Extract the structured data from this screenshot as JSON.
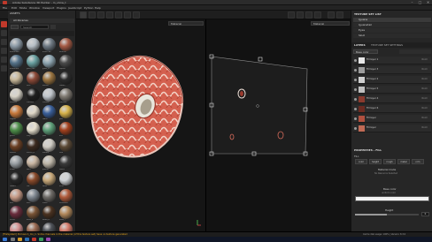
{
  "window": {
    "title": "Adobe Substance 3D Painter - m_show_t",
    "controls": {
      "min": "–",
      "max": "□",
      "close": "✕"
    }
  },
  "menu": [
    "File",
    "Edit",
    "Mode",
    "Window",
    "Viewport",
    "Plugins",
    "JavaScript",
    "Python",
    "Help"
  ],
  "shelf": {
    "title": "ASSETS",
    "category": "All libraries",
    "search_placeholder": "Search",
    "materials": [
      {
        "name": "aluminium",
        "color": "#8c9aa6"
      },
      {
        "name": "aluminium",
        "color": "#b7bfc6"
      },
      {
        "name": "alumi..bn",
        "color": "#6f7a84"
      },
      {
        "name": "artificial",
        "color": "#a55a44"
      },
      {
        "name": "aluminum",
        "color": "#55738a"
      },
      {
        "name": "glass_lam",
        "color": "#6aa1a1"
      },
      {
        "name": "glass_tr",
        "color": "#8fa6b2"
      },
      {
        "name": "asphalt",
        "color": "#4a4a4a"
      },
      {
        "name": "bone",
        "color": "#c9b99a"
      },
      {
        "name": "brick",
        "color": "#8c4a38"
      },
      {
        "name": "bronze",
        "color": "#9a7440"
      },
      {
        "name": "carbon",
        "color": "#2b2b2b"
      },
      {
        "name": "ceramic",
        "color": "#d8d4c8"
      },
      {
        "name": "charcoal",
        "color": "#1f1f1f"
      },
      {
        "name": "chrome",
        "color": "#c0c6cc"
      },
      {
        "name": "concrete",
        "color": "#807a72"
      },
      {
        "name": "copper",
        "color": "#c97a3c"
      },
      {
        "name": "cotton",
        "color": "#e0d8c8"
      },
      {
        "name": "fabric",
        "color": "#3a5f9a"
      },
      {
        "name": "gold",
        "color": "#d7b24a"
      },
      {
        "name": "green",
        "color": "#4e8f4a"
      },
      {
        "name": "ivory",
        "color": "#e8e2d0"
      },
      {
        "name": "jade",
        "color": "#5fa07a"
      },
      {
        "name": "lava",
        "color": "#a3411e"
      },
      {
        "name": "leather",
        "color": "#6b3f23"
      },
      {
        "name": "leather_b",
        "color": "#3b2a1f"
      },
      {
        "name": "marble",
        "color": "#d0ccc4"
      },
      {
        "name": "mud",
        "color": "#5c4a36"
      },
      {
        "name": "nickel",
        "color": "#9aa0a4"
      },
      {
        "name": "paint",
        "color": "#c9b6a2"
      },
      {
        "name": "plaster",
        "color": "#bfb7a9"
      },
      {
        "name": "plastic",
        "color": "#3a3a3a"
      },
      {
        "name": "rubber",
        "color": "#262626"
      },
      {
        "name": "rust",
        "color": "#8a4a2a"
      },
      {
        "name": "sand",
        "color": "#c9a97a"
      },
      {
        "name": "silver",
        "color": "#cfd3d6"
      },
      {
        "name": "skin",
        "color": "#c79a86"
      },
      {
        "name": "steel",
        "color": "#7f8790"
      },
      {
        "name": "stone",
        "color": "#6d6a66"
      },
      {
        "name": "terracotta",
        "color": "#b05a3a"
      },
      {
        "name": "velvet",
        "color": "#6a2c3c"
      },
      {
        "name": "wood_b",
        "color": "#7a5436"
      },
      {
        "name": "wood_d",
        "color": "#4a3220"
      },
      {
        "name": "wood_l",
        "color": "#b48a5c"
      },
      {
        "name": "rose",
        "color": "#d49090"
      },
      {
        "name": "skin_d",
        "color": "#9a6a52"
      },
      {
        "name": "slate",
        "color": "#4e5258"
      },
      {
        "name": "coral",
        "color": "#d47a6a"
      }
    ]
  },
  "viewport": {
    "left_mode": "Material",
    "right_mode": "Material"
  },
  "texture_set_list": {
    "title": "TEXTURE SET LIST",
    "items": [
      "Iguana",
      "Iguanatail",
      "Eyes",
      "Skull"
    ]
  },
  "layers": {
    "tab1": "LAYERS",
    "tab2": "TEXTURE SET SETTINGS",
    "channel": "Base color",
    "items": [
      {
        "name": "Fill layer 1",
        "blend": "Norm",
        "color": "#e7e7e7"
      },
      {
        "name": "Fill layer 3",
        "blend": "Norm",
        "color": "#9c9c9c"
      },
      {
        "name": "Fill layer 2",
        "blend": "Norm",
        "color": "#cfcfcf"
      },
      {
        "name": "Fill layer 5",
        "blend": "Norm",
        "color": "#bfbfbf"
      },
      {
        "name": "Fill layer 4",
        "blend": "Norm",
        "color": "#8a3a2e"
      },
      {
        "name": "Fill layer 6",
        "blend": "Norm",
        "color": "#6b2b22"
      },
      {
        "name": "Fill layer",
        "blend": "Norm",
        "color": "#b0503f"
      },
      {
        "name": "Fill layer",
        "blend": "Norm",
        "color": "#c06a55"
      }
    ]
  },
  "properties": {
    "title": "PROPERTIES - FILL",
    "section": "FILL",
    "channels": [
      "color",
      "height",
      "rough",
      "metal",
      "nrm"
    ],
    "material_mode": "Material mode",
    "no_resource": "No Resource Selected",
    "base_color": "Base color",
    "uniform_color": "uniform color",
    "height": "Height",
    "height_value": "0"
  },
  "status": {
    "message": "[FileSystem] Ps have 1_mn_1. Some channels in the material (of this texture set) have no texture generated",
    "right": "Cache disk usage: 100% | Version: 8.3.0"
  },
  "colors": {
    "accent": "#e3a31b",
    "skin": "#d46a5a",
    "bg": "#1a1a1a"
  }
}
